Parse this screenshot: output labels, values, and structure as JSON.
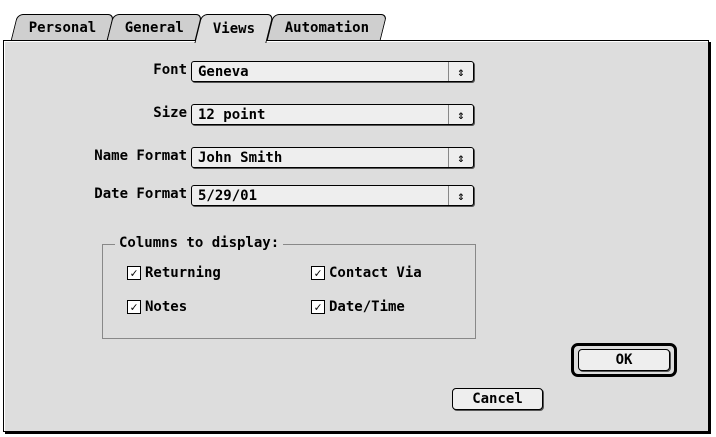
{
  "tabs": [
    "Personal",
    "General",
    "Views",
    "Automation"
  ],
  "active_tab": "Views",
  "fields": {
    "font": {
      "label": "Font",
      "value": "Geneva"
    },
    "size": {
      "label": "Size",
      "value": "12 point"
    },
    "name_format": {
      "label": "Name Format",
      "value": "John Smith"
    },
    "date_format": {
      "label": "Date Format",
      "value": "5/29/01"
    }
  },
  "popup_arrow_glyph": "⇕",
  "columns": {
    "title": "Columns to display:",
    "items": [
      {
        "label": "Returning",
        "checked": true
      },
      {
        "label": "Contact Via",
        "checked": true
      },
      {
        "label": "Notes",
        "checked": true
      },
      {
        "label": "Date/Time",
        "checked": true
      }
    ]
  },
  "buttons": {
    "cancel": "Cancel",
    "ok": "OK"
  }
}
